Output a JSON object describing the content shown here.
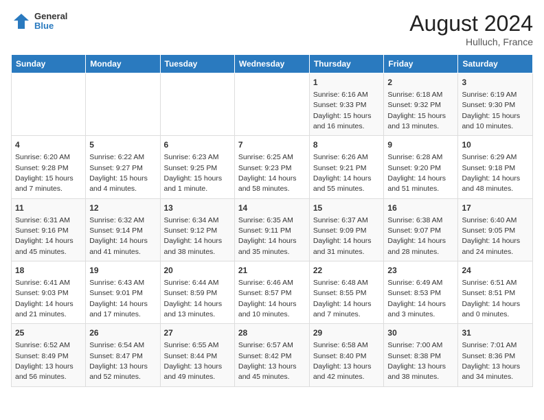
{
  "logo": {
    "general": "General",
    "blue": "Blue"
  },
  "header": {
    "month_year": "August 2024",
    "location": "Hulluch, France"
  },
  "days_of_week": [
    "Sunday",
    "Monday",
    "Tuesday",
    "Wednesday",
    "Thursday",
    "Friday",
    "Saturday"
  ],
  "weeks": [
    [
      {
        "day": "",
        "info": ""
      },
      {
        "day": "",
        "info": ""
      },
      {
        "day": "",
        "info": ""
      },
      {
        "day": "",
        "info": ""
      },
      {
        "day": "1",
        "info": "Sunrise: 6:16 AM\nSunset: 9:33 PM\nDaylight: 15 hours and 16 minutes."
      },
      {
        "day": "2",
        "info": "Sunrise: 6:18 AM\nSunset: 9:32 PM\nDaylight: 15 hours and 13 minutes."
      },
      {
        "day": "3",
        "info": "Sunrise: 6:19 AM\nSunset: 9:30 PM\nDaylight: 15 hours and 10 minutes."
      }
    ],
    [
      {
        "day": "4",
        "info": "Sunrise: 6:20 AM\nSunset: 9:28 PM\nDaylight: 15 hours and 7 minutes."
      },
      {
        "day": "5",
        "info": "Sunrise: 6:22 AM\nSunset: 9:27 PM\nDaylight: 15 hours and 4 minutes."
      },
      {
        "day": "6",
        "info": "Sunrise: 6:23 AM\nSunset: 9:25 PM\nDaylight: 15 hours and 1 minute."
      },
      {
        "day": "7",
        "info": "Sunrise: 6:25 AM\nSunset: 9:23 PM\nDaylight: 14 hours and 58 minutes."
      },
      {
        "day": "8",
        "info": "Sunrise: 6:26 AM\nSunset: 9:21 PM\nDaylight: 14 hours and 55 minutes."
      },
      {
        "day": "9",
        "info": "Sunrise: 6:28 AM\nSunset: 9:20 PM\nDaylight: 14 hours and 51 minutes."
      },
      {
        "day": "10",
        "info": "Sunrise: 6:29 AM\nSunset: 9:18 PM\nDaylight: 14 hours and 48 minutes."
      }
    ],
    [
      {
        "day": "11",
        "info": "Sunrise: 6:31 AM\nSunset: 9:16 PM\nDaylight: 14 hours and 45 minutes."
      },
      {
        "day": "12",
        "info": "Sunrise: 6:32 AM\nSunset: 9:14 PM\nDaylight: 14 hours and 41 minutes."
      },
      {
        "day": "13",
        "info": "Sunrise: 6:34 AM\nSunset: 9:12 PM\nDaylight: 14 hours and 38 minutes."
      },
      {
        "day": "14",
        "info": "Sunrise: 6:35 AM\nSunset: 9:11 PM\nDaylight: 14 hours and 35 minutes."
      },
      {
        "day": "15",
        "info": "Sunrise: 6:37 AM\nSunset: 9:09 PM\nDaylight: 14 hours and 31 minutes."
      },
      {
        "day": "16",
        "info": "Sunrise: 6:38 AM\nSunset: 9:07 PM\nDaylight: 14 hours and 28 minutes."
      },
      {
        "day": "17",
        "info": "Sunrise: 6:40 AM\nSunset: 9:05 PM\nDaylight: 14 hours and 24 minutes."
      }
    ],
    [
      {
        "day": "18",
        "info": "Sunrise: 6:41 AM\nSunset: 9:03 PM\nDaylight: 14 hours and 21 minutes."
      },
      {
        "day": "19",
        "info": "Sunrise: 6:43 AM\nSunset: 9:01 PM\nDaylight: 14 hours and 17 minutes."
      },
      {
        "day": "20",
        "info": "Sunrise: 6:44 AM\nSunset: 8:59 PM\nDaylight: 14 hours and 13 minutes."
      },
      {
        "day": "21",
        "info": "Sunrise: 6:46 AM\nSunset: 8:57 PM\nDaylight: 14 hours and 10 minutes."
      },
      {
        "day": "22",
        "info": "Sunrise: 6:48 AM\nSunset: 8:55 PM\nDaylight: 14 hours and 7 minutes."
      },
      {
        "day": "23",
        "info": "Sunrise: 6:49 AM\nSunset: 8:53 PM\nDaylight: 14 hours and 3 minutes."
      },
      {
        "day": "24",
        "info": "Sunrise: 6:51 AM\nSunset: 8:51 PM\nDaylight: 14 hours and 0 minutes."
      }
    ],
    [
      {
        "day": "25",
        "info": "Sunrise: 6:52 AM\nSunset: 8:49 PM\nDaylight: 13 hours and 56 minutes."
      },
      {
        "day": "26",
        "info": "Sunrise: 6:54 AM\nSunset: 8:47 PM\nDaylight: 13 hours and 52 minutes."
      },
      {
        "day": "27",
        "info": "Sunrise: 6:55 AM\nSunset: 8:44 PM\nDaylight: 13 hours and 49 minutes."
      },
      {
        "day": "28",
        "info": "Sunrise: 6:57 AM\nSunset: 8:42 PM\nDaylight: 13 hours and 45 minutes."
      },
      {
        "day": "29",
        "info": "Sunrise: 6:58 AM\nSunset: 8:40 PM\nDaylight: 13 hours and 42 minutes."
      },
      {
        "day": "30",
        "info": "Sunrise: 7:00 AM\nSunset: 8:38 PM\nDaylight: 13 hours and 38 minutes."
      },
      {
        "day": "31",
        "info": "Sunrise: 7:01 AM\nSunset: 8:36 PM\nDaylight: 13 hours and 34 minutes."
      }
    ]
  ]
}
